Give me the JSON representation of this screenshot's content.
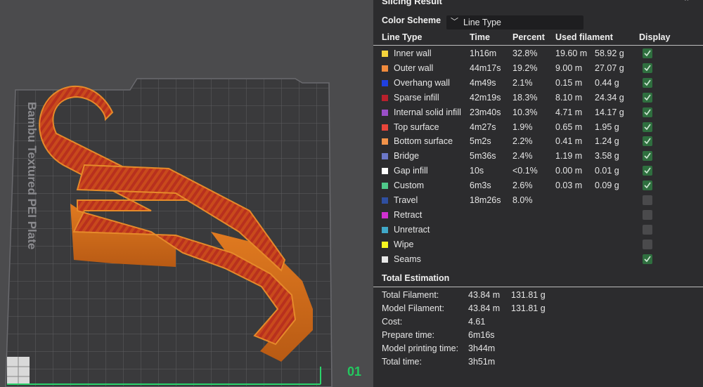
{
  "scene": {
    "plate_label": "Bambu Textured PEI Plate",
    "plate_number": "01"
  },
  "panel": {
    "title": "Slicing Result",
    "color_scheme_label": "Color Scheme",
    "color_scheme_value": "Line Type",
    "columns": {
      "line_type": "Line Type",
      "time": "Time",
      "percent": "Percent",
      "used_filament": "Used filament",
      "display": "Display"
    },
    "line_types": [
      {
        "name": "Inner wall",
        "color": "#f4d33c",
        "time": "1h16m",
        "percent": "32.8%",
        "length": "19.60 m",
        "weight": "58.92 g",
        "display": true
      },
      {
        "name": "Outer wall",
        "color": "#f08a3c",
        "time": "44m17s",
        "percent": "19.2%",
        "length": "9.00 m",
        "weight": "27.07 g",
        "display": true
      },
      {
        "name": "Overhang wall",
        "color": "#2040e0",
        "time": "4m49s",
        "percent": "2.1%",
        "length": "0.15 m",
        "weight": "0.44 g",
        "display": true
      },
      {
        "name": "Sparse infill",
        "color": "#b8202c",
        "time": "42m19s",
        "percent": "18.3%",
        "length": "8.10 m",
        "weight": "24.34 g",
        "display": true
      },
      {
        "name": "Internal solid infill",
        "color": "#9a4fc8",
        "time": "23m40s",
        "percent": "10.3%",
        "length": "4.71 m",
        "weight": "14.17 g",
        "display": true
      },
      {
        "name": "Top surface",
        "color": "#e8453a",
        "time": "4m27s",
        "percent": "1.9%",
        "length": "0.65 m",
        "weight": "1.95 g",
        "display": true
      },
      {
        "name": "Bottom surface",
        "color": "#f2934a",
        "time": "5m2s",
        "percent": "2.2%",
        "length": "0.41 m",
        "weight": "1.24 g",
        "display": true
      },
      {
        "name": "Bridge",
        "color": "#6c78c8",
        "time": "5m36s",
        "percent": "2.4%",
        "length": "1.19 m",
        "weight": "3.58 g",
        "display": true
      },
      {
        "name": "Gap infill",
        "color": "#ffffff",
        "time": "10s",
        "percent": "<0.1%",
        "length": "0.00 m",
        "weight": "0.01 g",
        "display": true
      },
      {
        "name": "Custom",
        "color": "#4fc98a",
        "time": "6m3s",
        "percent": "2.6%",
        "length": "0.03 m",
        "weight": "0.09 g",
        "display": true
      },
      {
        "name": "Travel",
        "color": "#2f4fa0",
        "time": "18m26s",
        "percent": "8.0%",
        "length": "",
        "weight": "",
        "display": false
      },
      {
        "name": "Retract",
        "color": "#d030d0",
        "time": "",
        "percent": "",
        "length": "",
        "weight": "",
        "display": false
      },
      {
        "name": "Unretract",
        "color": "#40a8c8",
        "time": "",
        "percent": "",
        "length": "",
        "weight": "",
        "display": false
      },
      {
        "name": "Wipe",
        "color": "#f5f520",
        "time": "",
        "percent": "",
        "length": "",
        "weight": "",
        "display": false
      },
      {
        "name": "Seams",
        "color": "#e8e8e8",
        "time": "",
        "percent": "",
        "length": "",
        "weight": "",
        "display": true
      }
    ],
    "total_estimation_label": "Total Estimation",
    "totals": [
      {
        "label": "Total Filament:",
        "value": "43.84 m",
        "value2": "131.81 g"
      },
      {
        "label": "Model Filament:",
        "value": "43.84 m",
        "value2": "131.81 g"
      },
      {
        "label": "Cost:",
        "value": "4.61",
        "value2": ""
      },
      {
        "label": "Prepare time:",
        "value": "6m16s",
        "value2": ""
      },
      {
        "label": "Model printing time:",
        "value": "3h44m",
        "value2": ""
      },
      {
        "label": "Total time:",
        "value": "3h51m",
        "value2": ""
      }
    ]
  }
}
